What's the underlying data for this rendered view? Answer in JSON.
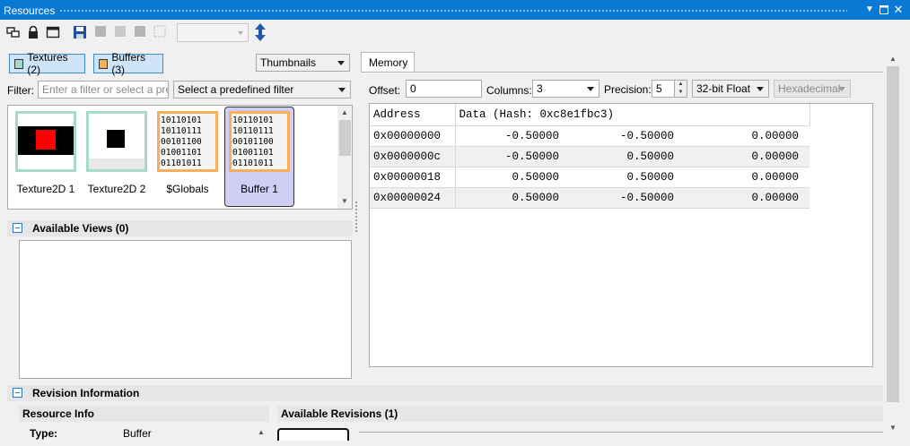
{
  "window": {
    "title": "Resources"
  },
  "left": {
    "toggles": [
      {
        "label": "Textures (2)",
        "color": "#a8d8c8"
      },
      {
        "label": "Buffers (3)",
        "color": "#f6b05a"
      }
    ],
    "view_mode": "Thumbnails",
    "filter": {
      "label": "Filter:",
      "placeholder": "Enter a filter or select a predefined filter",
      "predefined": "Select a predefined filter"
    },
    "resources": [
      {
        "name": "Texture2D 1",
        "kind": "texture"
      },
      {
        "name": "Texture2D 2",
        "kind": "texture"
      },
      {
        "name": "$Globals",
        "kind": "buffer",
        "bits": "10110101\n10110111\n00101100\n01001101\n01101011"
      },
      {
        "name": "Buffer 1",
        "kind": "buffer",
        "bits": "10110101\n10110111\n00101100\n01001101\n01101011",
        "selected": true
      }
    ],
    "available_views": {
      "title": "Available Views (0)"
    },
    "revision": {
      "title": "Revision Information",
      "resource_info": "Resource Info",
      "available_revisions": "Available Revisions (1)",
      "type_key": "Type:",
      "type_value": "Buffer"
    }
  },
  "memory": {
    "tab": "Memory",
    "offset_label": "Offset:",
    "offset_value": "0",
    "columns_label": "Columns:",
    "columns_value": "3",
    "precision_label": "Precision:",
    "precision_value": "5",
    "format": "32-bit Float",
    "hex_mode": "Hexadecimal",
    "header": {
      "address": "Address",
      "data": "Data  (Hash: 0xc8e1fbc3)"
    },
    "rows": [
      {
        "address": "0x00000000",
        "values": [
          "-0.50000",
          "-0.50000",
          "0.00000"
        ]
      },
      {
        "address": "0x0000000c",
        "values": [
          "-0.50000",
          "0.50000",
          "0.00000"
        ]
      },
      {
        "address": "0x00000018",
        "values": [
          "0.50000",
          "0.50000",
          "0.00000"
        ]
      },
      {
        "address": "0x00000024",
        "values": [
          "0.50000",
          "-0.50000",
          "0.00000"
        ]
      }
    ]
  },
  "colors": {
    "title_bar": "#0a79d4",
    "toggle_bg": "#cfe4f7",
    "selected_thumb": "#cfcff5",
    "buffer_border": "#f6b05a",
    "texture_border": "#a8d8c8"
  }
}
